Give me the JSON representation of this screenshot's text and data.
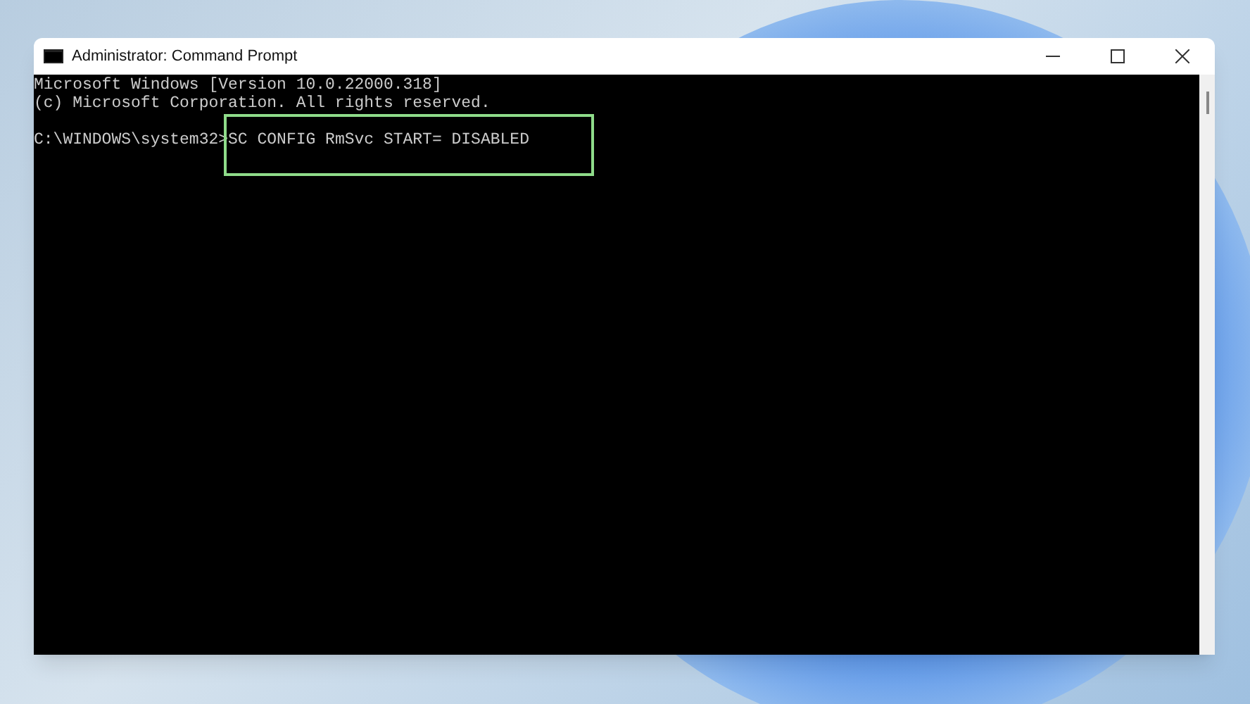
{
  "window": {
    "title": "Administrator: Command Prompt"
  },
  "console": {
    "lines": [
      "Microsoft Windows [Version 10.0.22000.318]",
      "(c) Microsoft Corporation. All rights reserved."
    ],
    "prompt": "C:\\WINDOWS\\system32>",
    "command": "SC CONFIG RmSvc START= DISABLED",
    "command_highlighted": true
  }
}
